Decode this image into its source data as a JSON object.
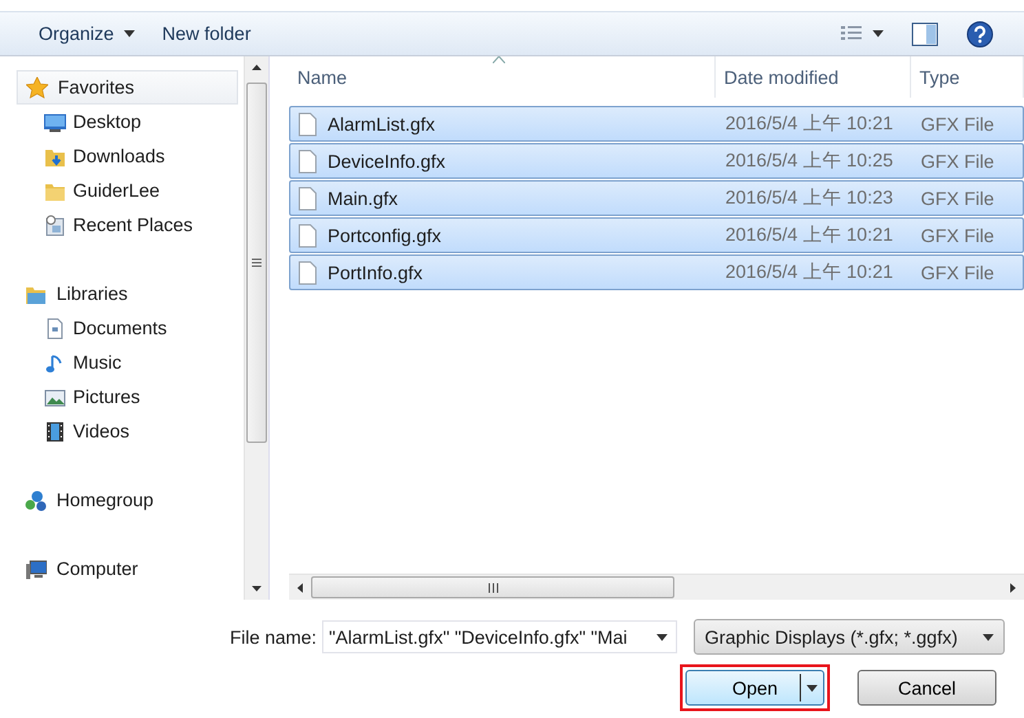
{
  "toolbar": {
    "organize": "Organize",
    "new_folder": "New folder"
  },
  "sidebar": {
    "groups": [
      {
        "label": "Favorites",
        "selected": true,
        "children": [
          {
            "label": "Desktop",
            "selected": false
          },
          {
            "label": "Downloads",
            "selected": false
          },
          {
            "label": "GuiderLee",
            "selected": false
          },
          {
            "label": "Recent Places",
            "selected": false
          }
        ]
      },
      {
        "label": "Libraries",
        "selected": false,
        "children": [
          {
            "label": "Documents",
            "selected": false
          },
          {
            "label": "Music",
            "selected": false
          },
          {
            "label": "Pictures",
            "selected": false
          },
          {
            "label": "Videos",
            "selected": false
          }
        ]
      },
      {
        "label": "Homegroup",
        "selected": false
      },
      {
        "label": "Computer",
        "selected": false
      }
    ]
  },
  "file_list": {
    "columns": [
      {
        "label": "Name",
        "sorted": true
      },
      {
        "label": "Date modified",
        "sorted": false
      },
      {
        "label": "Type",
        "sorted": false
      }
    ],
    "rows": [
      {
        "name": "AlarmList.gfx",
        "date": "2016/5/4 上午 10:21",
        "type": "GFX File",
        "selected": true
      },
      {
        "name": "DeviceInfo.gfx",
        "date": "2016/5/4 上午 10:25",
        "type": "GFX File",
        "selected": true
      },
      {
        "name": "Main.gfx",
        "date": "2016/5/4 上午 10:23",
        "type": "GFX File",
        "selected": true
      },
      {
        "name": "Portconfig.gfx",
        "date": "2016/5/4 上午 10:21",
        "type": "GFX File",
        "selected": true
      },
      {
        "name": "PortInfo.gfx",
        "date": "2016/5/4 上午 10:21",
        "type": "GFX File",
        "selected": true
      }
    ]
  },
  "footer": {
    "file_name_label": "File name:",
    "file_name_value": "\"AlarmList.gfx\" \"DeviceInfo.gfx\" \"Mai",
    "file_type": "Graphic Displays (*.gfx; *.ggfx)",
    "buttons": [
      {
        "kind": "split",
        "label": "Open",
        "focused": true,
        "highlighted": true
      },
      {
        "kind": "plain",
        "label": "Cancel",
        "focused": false,
        "highlighted": false
      }
    ]
  }
}
